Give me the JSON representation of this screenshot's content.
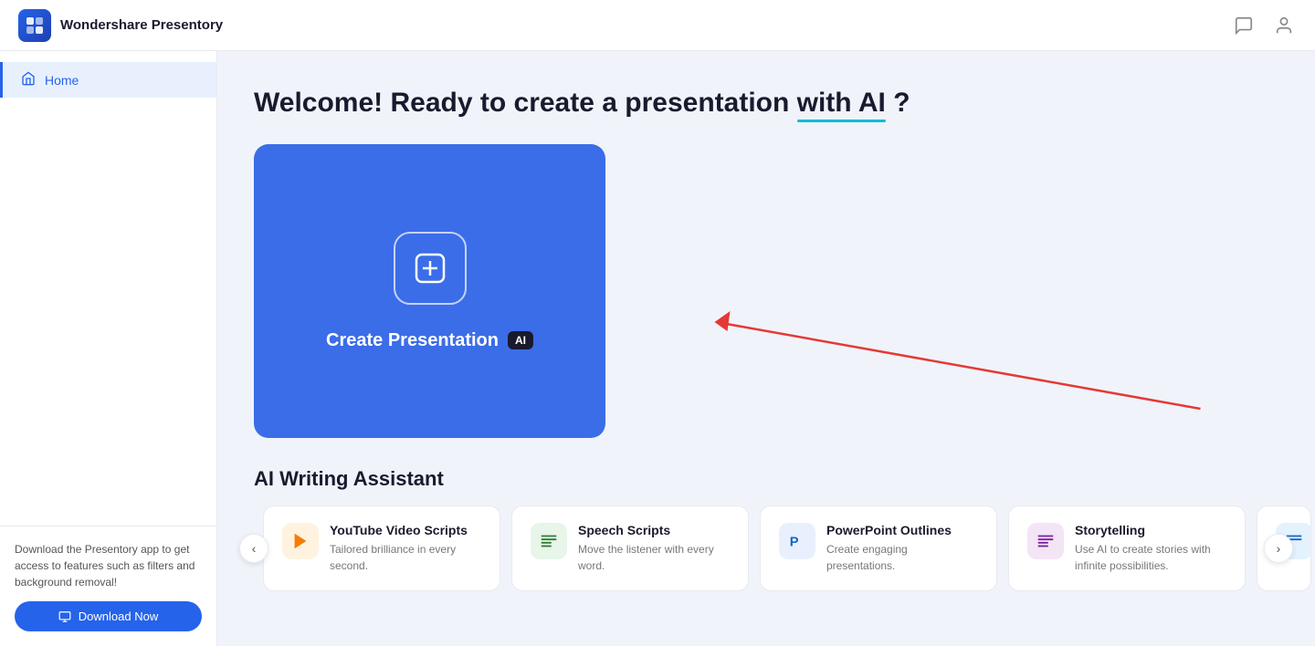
{
  "app": {
    "name": "Wondershare Presentory",
    "logo_letter": "P"
  },
  "header": {
    "title": "Welcome! Ready to create a presentation with AI ?"
  },
  "sidebar": {
    "items": [
      {
        "label": "Home",
        "icon": "🏠",
        "active": true
      }
    ],
    "download_promo": "Download the Presentory app to get access to features such as filters and background removal!",
    "download_btn": "Download Now"
  },
  "create_card": {
    "label": "Create Presentation",
    "ai_badge": "AI"
  },
  "ai_writing": {
    "section_title": "AI Writing Assistant",
    "cards": [
      {
        "title": "YouTube Video Scripts",
        "description": "Tailored brilliance in every second.",
        "icon": "▶",
        "icon_class": "icon-youtube"
      },
      {
        "title": "Speech Scripts",
        "description": "Move the listener with every word.",
        "icon": "≡",
        "icon_class": "icon-speech"
      },
      {
        "title": "PowerPoint Outlines",
        "description": "Create engaging presentations.",
        "icon": "P",
        "icon_class": "icon-powerpoint"
      },
      {
        "title": "Storytelling",
        "description": "Use AI to create stories with infinite possibilities.",
        "icon": "≡",
        "icon_class": "icon-storytelling"
      }
    ]
  },
  "carousel": {
    "prev_label": "‹",
    "next_label": "›"
  }
}
